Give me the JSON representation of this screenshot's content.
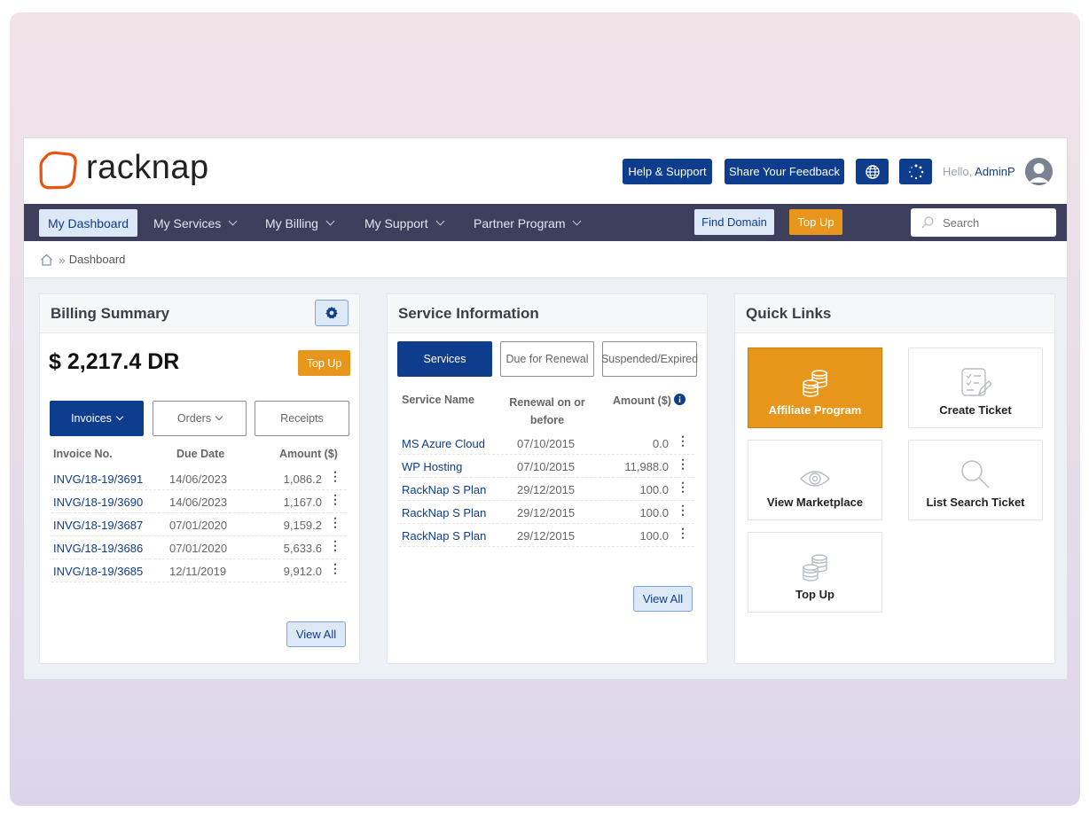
{
  "header": {
    "brand": "racknap",
    "help_label": "Help & Support",
    "feedback_label": "Share Your Feedback",
    "hello_prefix": "Hello,",
    "user": "AdminP"
  },
  "nav": {
    "items": [
      "My Dashboard",
      "My Services",
      "My Billing",
      "My Support",
      "Partner Program"
    ],
    "find_domain": "Find Domain",
    "top_up": "Top Up",
    "search_placeholder": "Search"
  },
  "breadcrumb": {
    "current": "Dashboard"
  },
  "billing": {
    "title": "Billing Summary",
    "balance": "$ 2,217.4 DR",
    "top_up": "Top Up",
    "tabs": [
      "Invoices",
      "Orders",
      "Receipts"
    ],
    "columns": [
      "Invoice No.",
      "Due Date",
      "Amount ($)"
    ],
    "rows": [
      {
        "no": "INVG/18-19/3691",
        "due": "14/06/2023",
        "amount": "1,086.2"
      },
      {
        "no": "INVG/18-19/3690",
        "due": "14/06/2023",
        "amount": "1,167.0"
      },
      {
        "no": "INVG/18-19/3687",
        "due": "07/01/2020",
        "amount": "9,159.2"
      },
      {
        "no": "INVG/18-19/3686",
        "due": "07/01/2020",
        "amount": "5,633.6"
      },
      {
        "no": "INVG/18-19/3685",
        "due": "12/11/2019",
        "amount": "9,912.0"
      }
    ],
    "view_all": "View All"
  },
  "service": {
    "title": "Service Information",
    "tabs": [
      "Services",
      "Due for Renewal",
      "Suspended/Expired"
    ],
    "columns": [
      "Service Name",
      "Renewal on or before",
      "Amount ($)"
    ],
    "rows": [
      {
        "name": "MS Azure Cloud",
        "renewal": "07/10/2015",
        "amount": "0.0"
      },
      {
        "name": "WP Hosting",
        "renewal": "07/10/2015",
        "amount": "11,988.0"
      },
      {
        "name": "RackNap S Plan",
        "renewal": "29/12/2015",
        "amount": "100.0"
      },
      {
        "name": "RackNap S Plan",
        "renewal": "29/12/2015",
        "amount": "100.0"
      },
      {
        "name": "RackNap S Plan",
        "renewal": "29/12/2015",
        "amount": "100.0"
      }
    ],
    "view_all": "View All"
  },
  "quicklinks": {
    "title": "Quick Links",
    "items": [
      "Affiliate Program",
      "Create Ticket",
      "View Marketplace",
      "List Search Ticket",
      "Top Up"
    ]
  },
  "colors": {
    "brand_blue": "#0d3d8c",
    "accent_orange": "#e8961b",
    "nav_bg": "#3d3f5c",
    "logo_orange": "#e8540f"
  }
}
